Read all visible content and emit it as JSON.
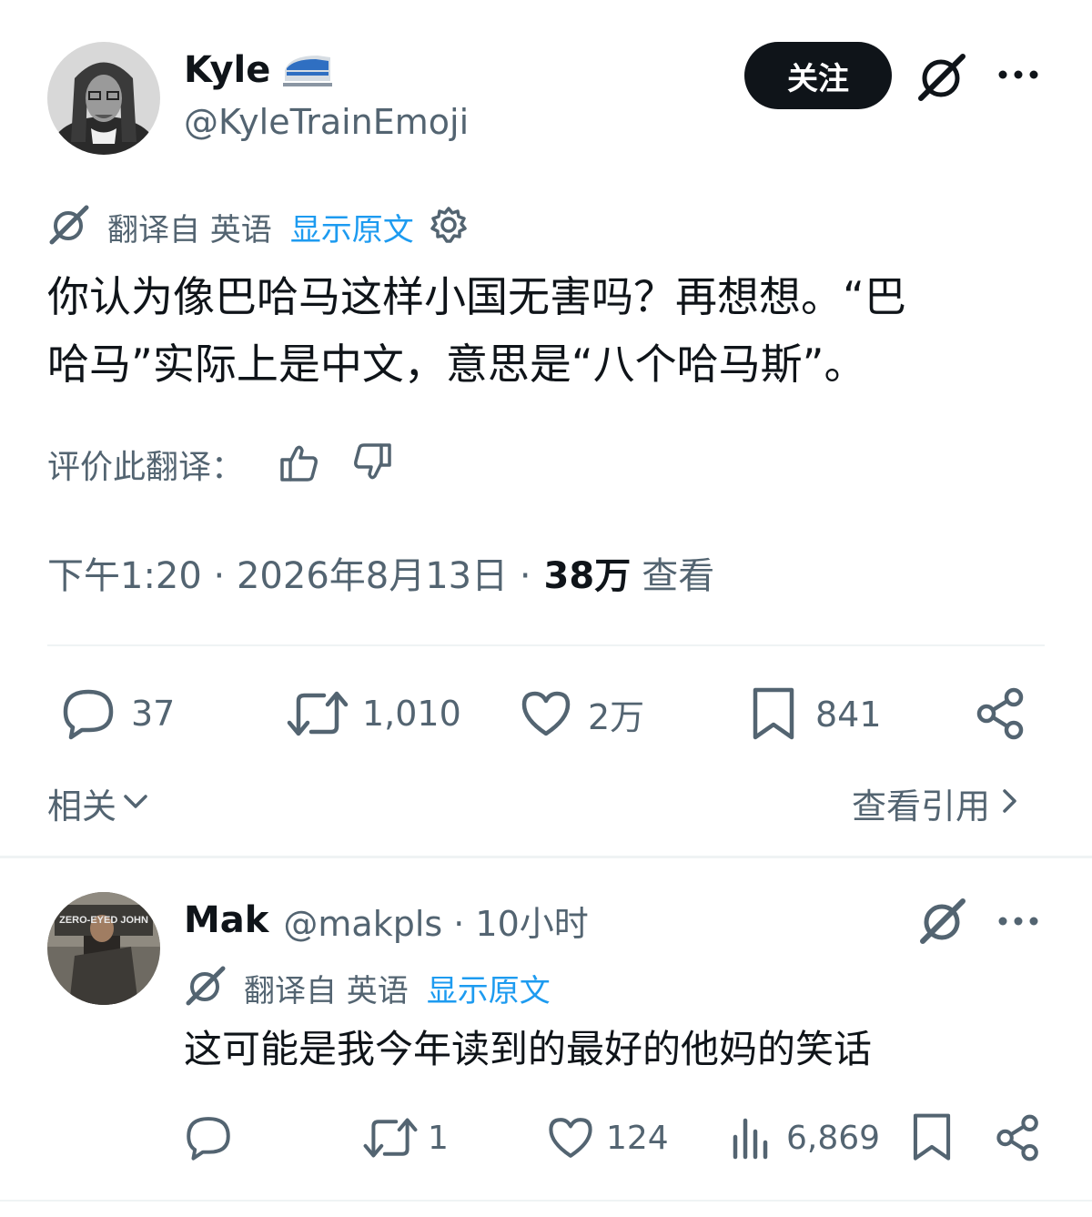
{
  "tweet": {
    "author_name": "Kyle",
    "author_emoji": "train-emoji",
    "author_handle": "@KyleTrainEmoji",
    "follow_label": "关注",
    "translate_from": "翻译自 英语",
    "show_original": "显示原文",
    "text_line1": "你认为像巴哈马这样小国无害吗？再想想。“巴",
    "text_line2": "哈马”实际上是中文，意思是“八个哈马斯”。",
    "rate_translation": "评价此翻译：",
    "time": "下午1:20 · 2026年8月13日 ·",
    "views_count": "38万",
    "views_label": "查看",
    "replies": "37",
    "retweets": "1,010",
    "likes": "2万",
    "bookmarks": "841",
    "related_label": "相关",
    "view_quotes": "查看引用"
  },
  "reply": {
    "author_name": "Mak",
    "meta": "@makpls · 10小时",
    "translate_from": "翻译自 英语",
    "show_original": "显示原文",
    "text": "这可能是我今年读到的最好的他妈的笑话",
    "replies": "",
    "retweets": "1",
    "likes": "124",
    "views": "6,869"
  },
  "colors": {
    "accent": "#1d9bf0",
    "text": "#0f1419",
    "muted": "#536471",
    "divider": "#eff3f4"
  },
  "icons": [
    "grok-icon",
    "more-icon",
    "settings-icon",
    "thumbs-up-icon",
    "thumbs-down-icon",
    "reply-icon",
    "retweet-icon",
    "like-icon",
    "bookmark-icon",
    "share-icon",
    "chevron-down-icon",
    "chevron-right-icon",
    "views-icon"
  ]
}
